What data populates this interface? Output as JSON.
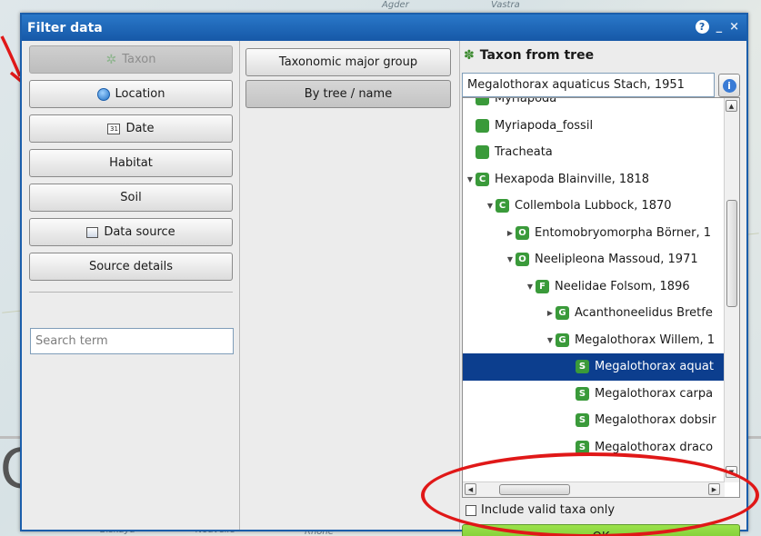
{
  "window": {
    "title": "Filter data",
    "help_label": "?",
    "minimize_glyph": "_",
    "close_glyph": "×"
  },
  "left_panel": {
    "buttons": [
      {
        "label": "Taxon",
        "icon": "gear-icon",
        "state": "disabled"
      },
      {
        "label": "Location",
        "icon": "globe-icon"
      },
      {
        "label": "Date",
        "icon": "calendar-icon"
      },
      {
        "label": "Habitat"
      },
      {
        "label": "Soil"
      },
      {
        "label": "Data source",
        "icon": "database-icon"
      },
      {
        "label": "Source details"
      }
    ],
    "calendar_icon_text": "31",
    "search_placeholder": "Search term"
  },
  "middle_panel": {
    "buttons": [
      {
        "label": "Taxonomic major group"
      },
      {
        "label": "By tree / name",
        "state": "active"
      }
    ]
  },
  "right_panel": {
    "title": "Taxon from tree",
    "taxon_value": "Megalothorax aquaticus Stach, 1951",
    "info_label": "i",
    "tree": [
      {
        "label": "Myriapoda",
        "badge": "",
        "depth": 0,
        "expander": ""
      },
      {
        "label": "Myriapoda_fossil",
        "badge": "",
        "depth": 0,
        "expander": ""
      },
      {
        "label": "Tracheata",
        "badge": "",
        "depth": 0,
        "expander": ""
      },
      {
        "label": "Hexapoda Blainville, 1818",
        "badge": "C",
        "depth": 0,
        "expander": "▼"
      },
      {
        "label": "Collembola Lubbock, 1870",
        "badge": "C",
        "depth": 1,
        "expander": "▼"
      },
      {
        "label": "Entomobryomorpha Börner, 1",
        "badge": "O",
        "depth": 2,
        "expander": "▶"
      },
      {
        "label": "Neelipleona Massoud, 1971",
        "badge": "O",
        "depth": 2,
        "expander": "▼"
      },
      {
        "label": "Neelidae Folsom, 1896",
        "badge": "F",
        "depth": 3,
        "expander": "▼"
      },
      {
        "label": "Acanthoneelidus Bretfe",
        "badge": "G",
        "depth": 4,
        "expander": "▶"
      },
      {
        "label": "Megalothorax Willem, 1",
        "badge": "G",
        "depth": 4,
        "expander": "▼"
      },
      {
        "label": "Megalothorax aquat",
        "badge": "S",
        "depth": 5,
        "expander": "",
        "selected": true
      },
      {
        "label": "Megalothorax carpa",
        "badge": "S",
        "depth": 5,
        "expander": ""
      },
      {
        "label": "Megalothorax dobsir",
        "badge": "S",
        "depth": 5,
        "expander": ""
      },
      {
        "label": "Megalothorax draco",
        "badge": "S",
        "depth": 5,
        "expander": ""
      }
    ],
    "include_valid_label": "Include valid taxa only",
    "include_valid_checked": false,
    "ok_label": "OK"
  },
  "colors": {
    "titlebar": "#1b5eab",
    "selection": "#0c3e8e",
    "ok_button": "#7ccc30",
    "badge": "#3a9a3a",
    "annotation_red": "#e01818"
  },
  "map_labels": [
    "Agder",
    "Vastra",
    "Biskaya",
    "Nouvelle",
    "Rhône"
  ],
  "map_text_fragment": "C"
}
